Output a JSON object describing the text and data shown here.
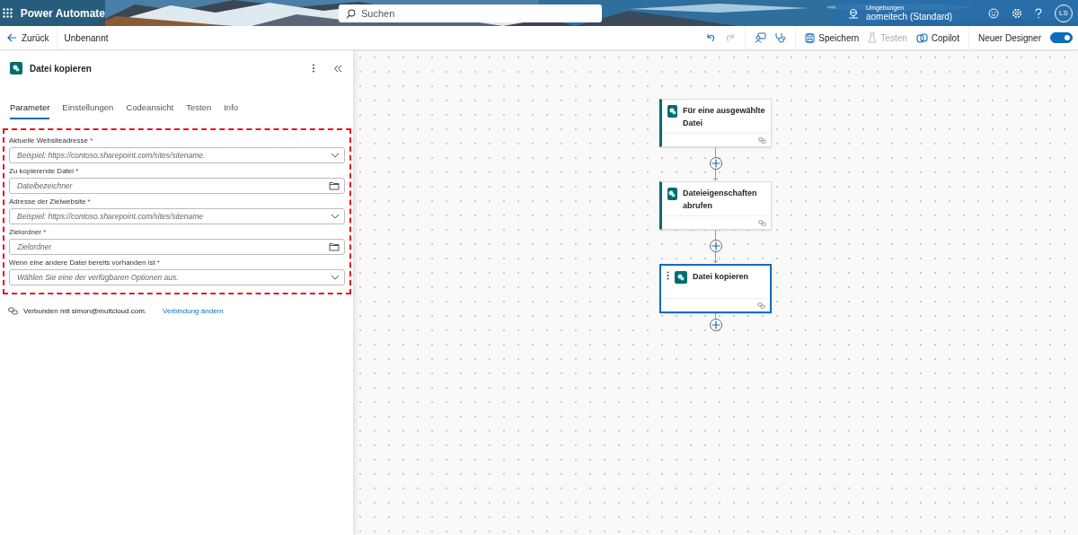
{
  "header": {
    "app_title": "Power Automate",
    "search": {
      "placeholder": "Suchen"
    },
    "environment": {
      "label": "Umgebungen",
      "name": "aomeitech (Standard)"
    },
    "avatar": "LS"
  },
  "toolbar": {
    "back": "Zurück",
    "flow_name": "Unbenannt",
    "actions": [
      {
        "kind": "undo",
        "disabled": false
      },
      {
        "kind": "redo",
        "disabled": true
      },
      {
        "kind": "chat",
        "disabled": false
      },
      {
        "kind": "checker",
        "disabled": false
      },
      {
        "kind": "save",
        "label": "Speichern",
        "disabled": false
      },
      {
        "kind": "test",
        "label": "Testen",
        "disabled": true
      },
      {
        "kind": "copilot",
        "label": "Copilot",
        "disabled": false
      }
    ],
    "toggle": {
      "label": "Neuer Designer",
      "on": true
    }
  },
  "panel": {
    "title": "Datei kopieren",
    "tabs": [
      {
        "label": "Parameter",
        "selected": true
      },
      {
        "label": "Einstellungen",
        "selected": false
      },
      {
        "label": "Codeansicht",
        "selected": false
      },
      {
        "label": "Testen",
        "selected": false
      },
      {
        "label": "Info",
        "selected": false
      }
    ],
    "fields": [
      {
        "label": "Aktuelle Websiteadresse",
        "required_mark": "*",
        "kind": "dropdown",
        "placeholder": "Beispiel: https://contoso.sharepoint.com/sites/sitename."
      },
      {
        "label": "Zu kopierende Datei",
        "required_mark": "*",
        "kind": "picker",
        "placeholder": "Dateibezeichner"
      },
      {
        "label": "Adresse der Zielwebsite",
        "required_mark": "*",
        "kind": "dropdown",
        "placeholder": "Beispiel: https://contoso.sharepoint.com/sites/sitename"
      },
      {
        "label": "Zielordner",
        "required_mark": "*",
        "kind": "picker",
        "placeholder": "Zielordner"
      },
      {
        "label": "Wenn eine andere Datei bereits vorhanden ist",
        "required_mark": "*",
        "kind": "dropdown",
        "placeholder": "Wählen Sie eine der verfügbaren Optionen aus."
      }
    ],
    "connection": {
      "text": "Verbunden mit simon@multcloud.com.",
      "link": "Verbindung ändern"
    }
  },
  "flow": [
    {
      "title": "Für eine ausgewählte Datei",
      "selected": false
    },
    {
      "title": "Dateieigenschaften abrufen",
      "selected": false
    },
    {
      "title": "Datei kopieren",
      "selected": true
    }
  ]
}
